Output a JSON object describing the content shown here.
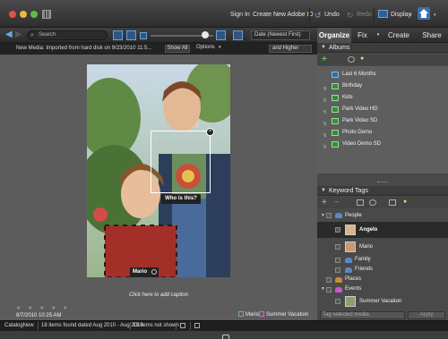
{
  "titlebar": {
    "sign_in": "Sign In",
    "create_id": "Create New Adobe ID",
    "undo": "Undo",
    "redo": "Redo",
    "display": "Display"
  },
  "toolbar": {
    "search_label": "Search",
    "sort_value": "Date (Newest First)"
  },
  "tabs": [
    {
      "label": "Organize",
      "active": true
    },
    {
      "label": "Fix",
      "active": false
    },
    {
      "label": "Create",
      "active": false
    },
    {
      "label": "Share",
      "active": false
    }
  ],
  "new_media": {
    "text": "New Media: Imported from hard disk on 9/23/2010 11:5...",
    "show_all": "Show All",
    "options": "Options",
    "rating_filter": "and Higher"
  },
  "main": {
    "face_prompt": "Who is this?",
    "face_tag": "Mario",
    "caption_placeholder": "Click here to add caption",
    "stars": "★ ★ ★ ★ ★",
    "date": "8/7/2010 10:25 AM",
    "tags": [
      "Mario",
      "Summer Vacation"
    ]
  },
  "status": {
    "catalog": "CatalogNew",
    "found": "18 items found dated Aug 2010 - Aug 2010",
    "not_shown": "13 items not shown"
  },
  "albums": {
    "title": "Albums",
    "items": [
      "Last 6 Months",
      "Birthday",
      "Kids",
      "Park Video HD",
      "Park Video SD",
      "Photo Demo",
      "Video Demo SD"
    ]
  },
  "keyword_tags": {
    "title": "Keyword Tags",
    "items": [
      {
        "label": "People"
      },
      {
        "label": "Angelo"
      },
      {
        "label": "Mario"
      },
      {
        "label": "Family"
      },
      {
        "label": "Friends"
      },
      {
        "label": "Places"
      },
      {
        "label": "Events"
      },
      {
        "label": "Summer Vacation"
      }
    ],
    "search_placeholder": "Tag selected media",
    "apply": "Apply"
  },
  "colors": {
    "accent_blue": "#3a70b0",
    "album_green": "#3c8a3c"
  }
}
